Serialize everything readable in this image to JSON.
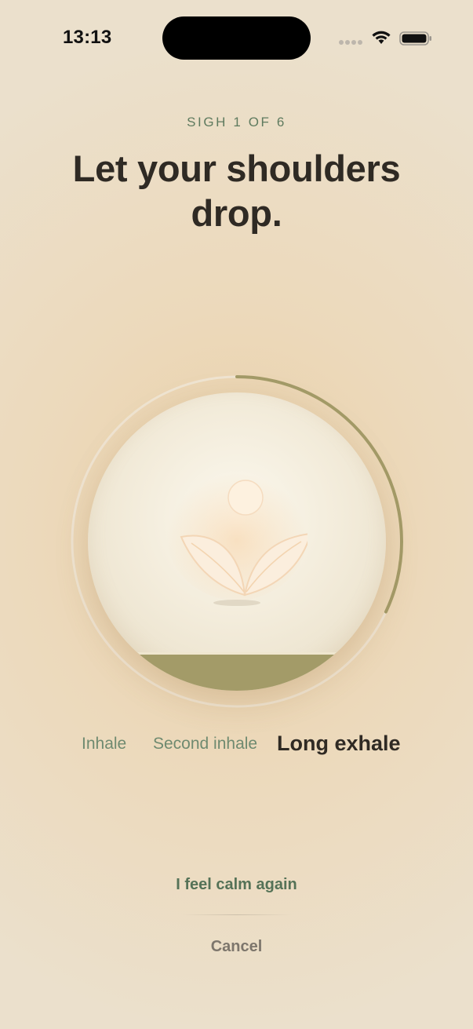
{
  "status_bar": {
    "time": "13:13",
    "signal_icon": "cellular-signal-icon",
    "wifi_icon": "wifi-icon",
    "battery_icon": "battery-icon"
  },
  "session": {
    "step_label": "SIGH 1 OF 6",
    "title": "Let your shoulders drop."
  },
  "breath": {
    "progress": 0.32,
    "fill_level": 0.13,
    "center_icon": "sprout-icon",
    "phases": [
      {
        "label": "Inhale",
        "active": false
      },
      {
        "label": "Second inhale",
        "active": false
      },
      {
        "label": "Long exhale",
        "active": true
      }
    ]
  },
  "actions": {
    "calm_label": "I feel calm again",
    "cancel_label": "Cancel"
  },
  "colors": {
    "accent": "#a39b68",
    "label_green": "#5f7b5f",
    "text_dark": "#2f2a24",
    "muted": "#7d766c"
  }
}
